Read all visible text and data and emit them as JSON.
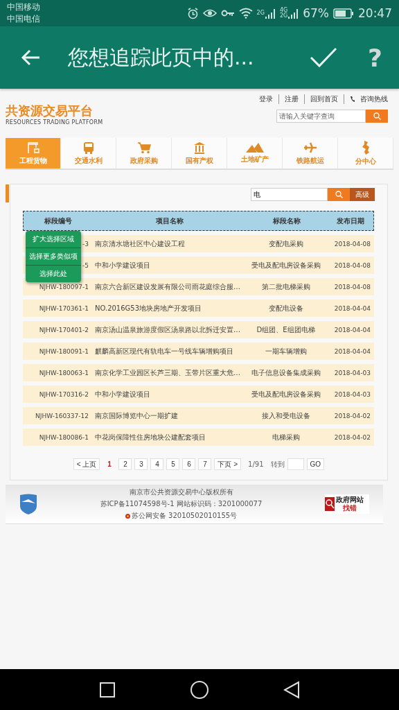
{
  "status_bar": {
    "carriers": [
      "中国移动",
      "中国电信"
    ],
    "net_2g": "2G",
    "net_4g": "4G",
    "net_4g_2": "2G",
    "battery_text": "67%",
    "time": "20:47"
  },
  "toolbar": {
    "title": "您想追踪此页中的...",
    "help": "?"
  },
  "site": {
    "top_links": [
      "登录",
      "注册",
      "回到首页"
    ],
    "hotline": "咨询热线",
    "logo_title": "共资源交易平台",
    "logo_subtitle": "RESOURCES TRADING PLATFORM",
    "search_placeholder": "请输入关键字查询",
    "nav": [
      {
        "label": "工程货物",
        "selected": true
      },
      {
        "label": "交通水利",
        "selected": false
      },
      {
        "label": "政府采购",
        "selected": false
      },
      {
        "label": "国有产权",
        "selected": false
      },
      {
        "label": "土地矿产",
        "selected": false
      },
      {
        "label": "铁路航运",
        "selected": false
      },
      {
        "label": "分中心",
        "selected": false
      }
    ]
  },
  "filter": {
    "value": "电",
    "advanced": "高级"
  },
  "table": {
    "columns": [
      "标段编号",
      "项目名称",
      "标段名称",
      "发布日期"
    ],
    "rows": [
      [
        "-3",
        "南京清水塘社区中心建设工程",
        "变配电采购",
        "2018-04-08"
      ],
      [
        "-5",
        "中和小学建设项目",
        "受电及配电房设备采购",
        "2018-04-08"
      ],
      [
        "NJHW-180097-1",
        "南京六合新区建设发展有限公司雨花庭综合服…",
        "第二批电梯采购",
        "2018-04-08"
      ],
      [
        "NJHW-170361-1",
        "NO.2016G53地块房地产开发项目",
        "变配电设备",
        "2018-04-04"
      ],
      [
        "NJHW-170401-2",
        "南京汤山温泉旅游度假区汤泉路以北拆迁安置…",
        "D组团、E组团电梯",
        "2018-04-04"
      ],
      [
        "NJHW-180091-1",
        "麒麟高新区现代有轨电车一号线车辆增购项目",
        "一期车辆增购",
        "2018-04-04"
      ],
      [
        "NJHW-180063-1",
        "南京化学工业园区长芦三期、玉带片区重大危…",
        "电子信息设备集成采购",
        "2018-04-03"
      ],
      [
        "NJHW-170316-2",
        "中和小学建设项目",
        "受电及配电房设备采购",
        "2018-04-03"
      ],
      [
        "NJHW-160337-12",
        "南京国际博览中心一期扩建",
        "接入和受电设备",
        "2018-04-02"
      ],
      [
        "NJHW-180086-1",
        "中花岗保障性住房地块公建配套项目",
        "电梯采购",
        "2018-04-02"
      ]
    ]
  },
  "context_menu": [
    "扩大选择区域",
    "选择更多类似项",
    "选择此处"
  ],
  "pagination": {
    "prev": "< 上页",
    "pages": [
      {
        "label": "1",
        "selected": true
      },
      {
        "label": "2",
        "selected": false
      },
      {
        "label": "3",
        "selected": false
      },
      {
        "label": "4",
        "selected": false
      },
      {
        "label": "5",
        "selected": false
      },
      {
        "label": "6",
        "selected": false
      },
      {
        "label": "7",
        "selected": false
      }
    ],
    "next": "下页 >",
    "count": "1/91",
    "goto_label": "转到",
    "go": "GO"
  },
  "footer": {
    "lines": [
      "南京市公共资源交易中心版权所有",
      "苏ICP备11074598号-1 网站标识码：3201000077",
      "苏公网安备 32010502010155号"
    ],
    "badge_title": "政府网站",
    "badge_sub": "找错"
  }
}
